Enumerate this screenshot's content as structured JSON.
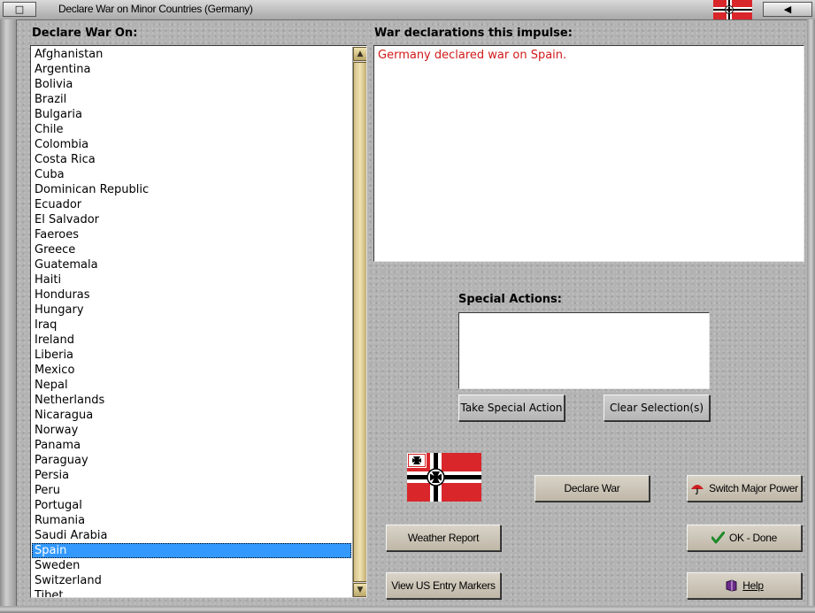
{
  "window": {
    "title": "Declare War on Minor Countries (Germany)",
    "title_left_button_icon": "restore-icon",
    "title_right_button_icon": "minimize-icon"
  },
  "left_panel": {
    "heading": "Declare War On:",
    "countries": [
      "Afghanistan",
      "Argentina",
      "Bolivia",
      "Brazil",
      "Bulgaria",
      "Chile",
      "Colombia",
      "Costa Rica",
      "Cuba",
      "Dominican Republic",
      "Ecuador",
      "El Salvador",
      "Faeroes",
      "Greece",
      "Guatemala",
      "Haiti",
      "Honduras",
      "Hungary",
      "Iraq",
      "Ireland",
      "Liberia",
      "Mexico",
      "Nepal",
      "Netherlands",
      "Nicaragua",
      "Norway",
      "Panama",
      "Paraguay",
      "Persia",
      "Peru",
      "Portugal",
      "Rumania",
      "Saudi Arabia",
      "Spain",
      "Sweden",
      "Switzerland",
      "Tibet"
    ],
    "selected_country": "Spain"
  },
  "declarations": {
    "heading": "War declarations this impulse:",
    "lines": [
      "Germany declared war on Spain."
    ],
    "text_color": "#d11a1a"
  },
  "special_actions": {
    "heading": "Special Actions:",
    "take_label": "Take Special Action",
    "clear_label": "Clear Selection(s)"
  },
  "buttons": {
    "declare_war": "Declare War",
    "switch_major_power": "Switch Major Power",
    "weather_report": "Weather Report",
    "ok_done": "OK - Done",
    "view_us_entry": "View US Entry Markers",
    "help": "Help"
  },
  "icons": {
    "switch": "umbrella-switch-icon",
    "ok": "green-checkmark-icon",
    "help": "help-book-icon",
    "flag": "german-war-ensign-icon"
  },
  "colors": {
    "selection": "#3399ff",
    "flag_red": "#d9262b",
    "checkmark": "#1e8a2a"
  }
}
